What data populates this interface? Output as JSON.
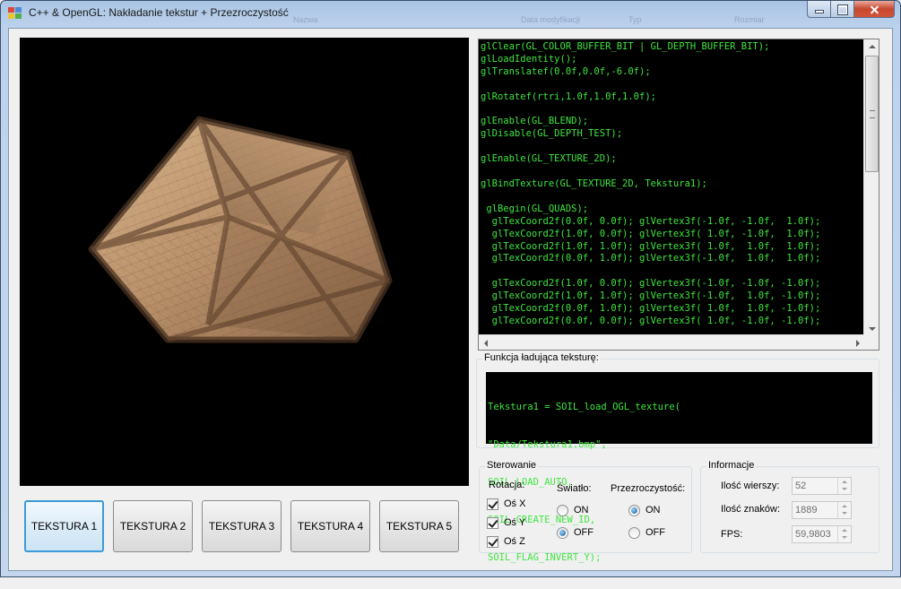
{
  "window": {
    "title": "C++ & OpenGL: Nakładanie tekstur + Przezroczystość",
    "ghost_headers": [
      "Nazwa",
      "Data modyfikacji",
      "Typ",
      "Rozmiar"
    ]
  },
  "code_editor": {
    "lines": [
      "glClear(GL_COLOR_BUFFER_BIT | GL_DEPTH_BUFFER_BIT);",
      "glLoadIdentity();",
      "glTranslatef(0.0f,0.0f,-6.0f);",
      "",
      "glRotatef(rtri,1.0f,1.0f,1.0f);",
      "",
      "glEnable(GL_BLEND);",
      "glDisable(GL_DEPTH_TEST);",
      "",
      "glEnable(GL_TEXTURE_2D);",
      "",
      "glBindTexture(GL_TEXTURE_2D, Tekstura1);",
      "",
      " glBegin(GL_QUADS);",
      "  glTexCoord2f(0.0f, 0.0f); glVertex3f(-1.0f, -1.0f,  1.0f);",
      "  glTexCoord2f(1.0f, 0.0f); glVertex3f( 1.0f, -1.0f,  1.0f);",
      "  glTexCoord2f(1.0f, 1.0f); glVertex3f( 1.0f,  1.0f,  1.0f);",
      "  glTexCoord2f(0.0f, 1.0f); glVertex3f(-1.0f,  1.0f,  1.0f);",
      "",
      "  glTexCoord2f(1.0f, 0.0f); glVertex3f(-1.0f, -1.0f, -1.0f);",
      "  glTexCoord2f(1.0f, 1.0f); glVertex3f(-1.0f,  1.0f, -1.0f);",
      "  glTexCoord2f(0.0f, 1.0f); glVertex3f( 1.0f,  1.0f, -1.0f);",
      "  glTexCoord2f(0.0f, 0.0f); glVertex3f( 1.0f, -1.0f, -1.0f);"
    ],
    "text_color": "#3ee63e"
  },
  "texture_loader": {
    "title": "Funkcja ładująca teksturę:",
    "lines": [
      "Tekstura1 = SOIL_load_OGL_texture(",
      "\"Data/Tekstura1.bmp\",",
      "SOIL_LOAD_AUTO,",
      "SOIL_CREATE_NEW_ID,",
      "SOIL_FLAG_INVERT_Y);"
    ]
  },
  "texture_buttons": [
    "TEKSTURA 1",
    "TEKSTURA 2",
    "TEKSTURA 3",
    "TEKSTURA 4",
    "TEKSTURA 5"
  ],
  "active_texture": "TEKSTURA 1",
  "controls": {
    "title": "Sterowanie",
    "rotation_label": "Rotacja:",
    "axes": [
      {
        "label": "Oś X",
        "checked": true
      },
      {
        "label": "Oś Y",
        "checked": true
      },
      {
        "label": "Oś Z",
        "checked": true
      }
    ],
    "light_label": "Światło:",
    "light_options": [
      {
        "label": "ON",
        "selected": false
      },
      {
        "label": "OFF",
        "selected": true
      }
    ],
    "transparency_label": "Przezroczystość:",
    "transparency_options": [
      {
        "label": "ON",
        "selected": true
      },
      {
        "label": "OFF",
        "selected": false
      }
    ]
  },
  "info": {
    "title": "Informacje",
    "rows_label": "Ilość wierszy:",
    "rows_value": "52",
    "chars_label": "Ilość znaków:",
    "chars_value": "1889",
    "fps_label": "FPS:",
    "fps_value": "59,9803"
  }
}
